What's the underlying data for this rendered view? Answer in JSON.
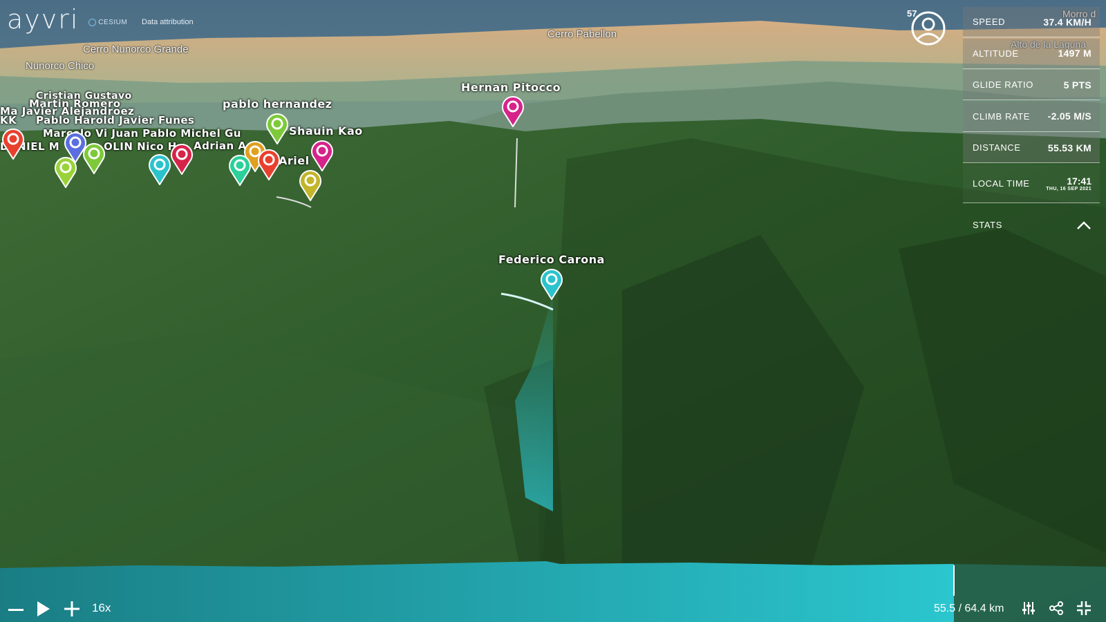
{
  "branding": {
    "logo": "ayvri",
    "cesium": "CESIUM",
    "attribution": "Data attribution"
  },
  "places": [
    "Cerro Nunorco Grande",
    "Nunorco Chico",
    "Cerro Pabellon",
    "Alto de la Laguna",
    "Morro d"
  ],
  "pilots": {
    "hernan": "Hernan Pitocco",
    "federico": "Federico Carona",
    "pablo": "pablo hernandez",
    "martin": "Martin Romero",
    "javier_alejandro": "Ma Javier Alejandroez",
    "pablo_harold": "Pablo Harold Javier Funes",
    "marcelo": "Marcelo Vi Juan Pablo Michel Gu",
    "daniel": "DANIEL M",
    "olin": "OLIN Nico Ha",
    "adrian": "Adrian A",
    "shauin": "Shauin Kao",
    "ariel": "Ariel",
    "cristian": "Cristian Gustavo",
    "kk": "KK"
  },
  "user": {
    "count": "57"
  },
  "stats": {
    "speed": {
      "label": "SPEED",
      "value": "37.4 KM/H"
    },
    "altitude": {
      "label": "ALTITUDE",
      "value": "1497 M"
    },
    "glide": {
      "label": "GLIDE RATIO",
      "value": "5 PTS"
    },
    "climb": {
      "label": "CLIMB RATE",
      "value": "-2.05 M/S"
    },
    "distance": {
      "label": "DISTANCE",
      "value": "55.53 KM"
    },
    "time": {
      "label": "LOCAL TIME",
      "value": "17:41",
      "date": "THU, 16 SEP 2021"
    },
    "toggle": "STATS"
  },
  "playback": {
    "speed": "16x",
    "progress_fraction": 0.862,
    "distance": "55.5 / 64.4 km"
  },
  "colors": {
    "accent": "#2bc3cc",
    "pin_pink": "#d6238a",
    "pin_green": "#7ec93a"
  }
}
